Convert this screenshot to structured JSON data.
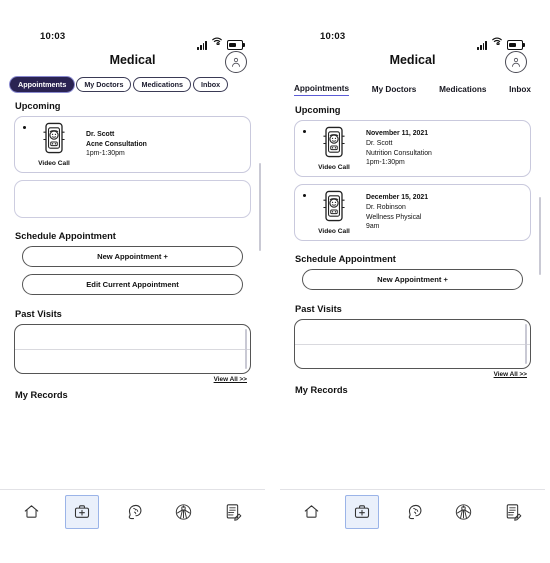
{
  "screens": [
    {
      "id": "left",
      "status_bar": {
        "time": "10:03",
        "signal_icon": "signal-bars-icon",
        "wifi_icon": "wifi-icon",
        "battery_icon": "battery-icon"
      },
      "header": {
        "title": "Medical",
        "avatar_icon": "user-avatar-icon"
      },
      "tabs_style": "pill",
      "tabs": [
        {
          "label": "Appointments",
          "active": true
        },
        {
          "label": "My Doctors",
          "active": false
        },
        {
          "label": "Medications",
          "active": false
        },
        {
          "label": "Inbox",
          "active": false
        }
      ],
      "upcoming": {
        "title": "Upcoming",
        "cards": [
          {
            "icon_label": "Video Call",
            "icon": "video-call-icon",
            "date": "",
            "doctor": "Dr. Scott",
            "reason": "Acne Consultation",
            "time": "1pm-1:30pm"
          }
        ],
        "empty_card": true
      },
      "schedule": {
        "title": "Schedule Appointment",
        "buttons": [
          {
            "label": "New Appointment  +"
          },
          {
            "label": "Edit Current Appointment"
          }
        ]
      },
      "past_visits": {
        "title": "Past Visits",
        "view_all": "View All >>"
      },
      "my_records": {
        "title": "My Records"
      },
      "bottom_nav": [
        {
          "icon": "home-icon",
          "active": false
        },
        {
          "icon": "medical-bag-icon",
          "active": true
        },
        {
          "icon": "brain-head-icon",
          "active": false
        },
        {
          "icon": "body-anatomy-icon",
          "active": false
        },
        {
          "icon": "clipboard-pencil-icon",
          "active": false
        }
      ]
    },
    {
      "id": "right",
      "status_bar": {
        "time": "10:03",
        "signal_icon": "signal-bars-icon",
        "wifi_icon": "wifi-icon",
        "battery_icon": "battery-icon"
      },
      "header": {
        "title": "Medical",
        "avatar_icon": "user-avatar-icon"
      },
      "tabs_style": "underline",
      "tabs": [
        {
          "label": "Appointments",
          "active": true
        },
        {
          "label": "My Doctors",
          "active": false
        },
        {
          "label": "Medications",
          "active": false
        },
        {
          "label": "Inbox",
          "active": false
        }
      ],
      "upcoming": {
        "title": "Upcoming",
        "cards": [
          {
            "icon_label": "Video Call",
            "icon": "video-call-icon",
            "date": "November 11, 2021",
            "doctor": "Dr. Scott",
            "reason": "Nutrition Consultation",
            "time": "1pm-1:30pm"
          },
          {
            "icon_label": "Video Call",
            "icon": "video-call-icon",
            "date": "December 15, 2021",
            "doctor": "Dr.  Robinson",
            "reason": "Wellness Physical",
            "time": "9am"
          }
        ],
        "empty_card": false
      },
      "schedule": {
        "title": "Schedule Appointment",
        "buttons": [
          {
            "label": "New Appointment  +"
          }
        ]
      },
      "past_visits": {
        "title": "Past Visits",
        "view_all": "View All >>"
      },
      "my_records": {
        "title": "My Records"
      },
      "bottom_nav": [
        {
          "icon": "home-icon",
          "active": false
        },
        {
          "icon": "medical-bag-icon",
          "active": true
        },
        {
          "icon": "brain-head-icon",
          "active": false
        },
        {
          "icon": "body-anatomy-icon",
          "active": false
        },
        {
          "icon": "clipboard-pencil-icon",
          "active": false
        }
      ]
    }
  ],
  "colors": {
    "active_pill_bg": "#2a2352",
    "active_tab_underline": "#5b5bd6",
    "active_nav_bg": "#eaf0fb",
    "active_nav_border": "#9bb4e8",
    "card_border": "#c9c9dd",
    "text": "#111111"
  }
}
